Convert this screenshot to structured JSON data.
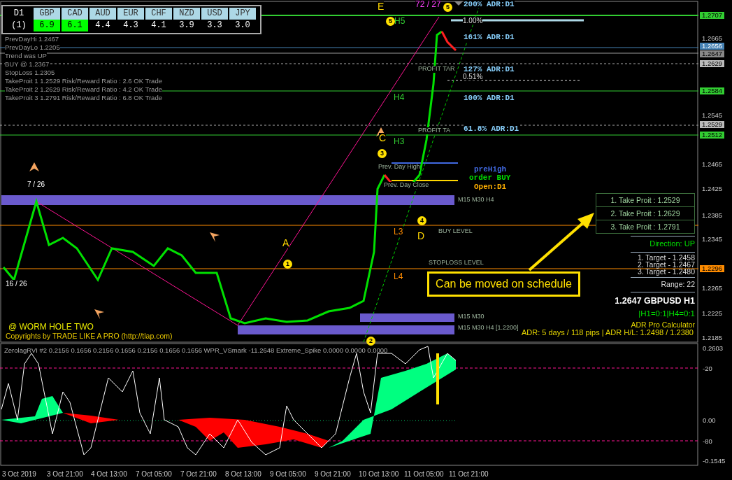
{
  "currency_table": {
    "timeframe": "D1",
    "period": "(1)",
    "currencies": [
      {
        "code": "GBP",
        "value": "6.9",
        "highlighted": true
      },
      {
        "code": "CAD",
        "value": "6.1",
        "highlighted": true
      },
      {
        "code": "AUD",
        "value": "4.4",
        "highlighted": false
      },
      {
        "code": "EUR",
        "value": "4.3",
        "highlighted": false
      },
      {
        "code": "CHF",
        "value": "4.1",
        "highlighted": false
      },
      {
        "code": "NZD",
        "value": "3.9",
        "highlighted": false
      },
      {
        "code": "USD",
        "value": "3.3",
        "highlighted": false
      },
      {
        "code": "JPY",
        "value": "3.0",
        "highlighted": false
      }
    ]
  },
  "info_lines": [
    "PrevDayHi 1.2467",
    "PrevDayLo 1.2205",
    "Trend was UP",
    "BUY @ 1.2367",
    "StopLoss 1.2305",
    "TakeProit 1 1.2529 Risk/Reward Ratio : 2.6 OK Trade",
    "TakeProit 2 1.2629 Risk/Reward Ratio : 4.2 OK Trade",
    "TakeProit 3 1.2791 Risk/Reward Ratio : 6.8 OK Trade"
  ],
  "chart_labels": [
    {
      "text": "E",
      "kind": "yellow"
    },
    {
      "text": "72 / 27",
      "kind": "magenta"
    },
    {
      "text": "200% ADR:D1",
      "kind": "adr"
    },
    {
      "text": "H5",
      "kind": "green"
    },
    {
      "text": "1.00%",
      "kind": "pct"
    },
    {
      "text": "161% ADR:D1",
      "kind": "adr"
    },
    {
      "text": "PROFIT TAR",
      "kind": "gray"
    },
    {
      "text": "127% ADR:D1",
      "kind": "adr"
    },
    {
      "text": "0.51%",
      "kind": "pct"
    },
    {
      "text": "100% ADR:D1",
      "kind": "adr"
    },
    {
      "text": "H4",
      "kind": "green"
    },
    {
      "text": "PROFIT TA",
      "kind": "gray"
    },
    {
      "text": "61.8% ADR:D1",
      "kind": "adr"
    },
    {
      "text": "C",
      "kind": "yellow"
    },
    {
      "text": "H3",
      "kind": "green"
    },
    {
      "text": "Prev. Day High",
      "kind": "gray"
    },
    {
      "text": "preHigh",
      "kind": "blue-bold"
    },
    {
      "text": "order BUY",
      "kind": "green-bold"
    },
    {
      "text": "Prev. Day Close",
      "kind": "gray"
    },
    {
      "text": "Open:D1",
      "kind": "orange-bold"
    },
    {
      "text": "7 / 26",
      "kind": "white"
    },
    {
      "text": "M15 M30 H4",
      "kind": "gray"
    },
    {
      "text": "L3",
      "kind": "orange"
    },
    {
      "text": "BUY LEVEL",
      "kind": "gray"
    },
    {
      "text": "D",
      "kind": "yellow"
    },
    {
      "text": "A",
      "kind": "yellow"
    },
    {
      "text": "STOPLOSS LEVEL",
      "kind": "gray"
    },
    {
      "text": "L4",
      "kind": "orange"
    },
    {
      "text": "16 / 26",
      "kind": "white"
    },
    {
      "text": "M15 M30",
      "kind": "gray"
    },
    {
      "text": "M15 M30 H4  [1.2200]",
      "kind": "gray"
    }
  ],
  "wave_markers": [
    {
      "text": "5"
    },
    {
      "text": "5"
    },
    {
      "text": "3"
    },
    {
      "text": "4"
    },
    {
      "text": "1"
    },
    {
      "text": "2"
    }
  ],
  "price_axis": [
    {
      "text": "1.2707",
      "kind": "green"
    },
    {
      "text": "1.2665",
      "kind": "plain"
    },
    {
      "text": "1.2656",
      "kind": "blue"
    },
    {
      "text": "1.2647",
      "kind": "gray"
    },
    {
      "text": "1.2629",
      "kind": "light"
    },
    {
      "text": "1.2584",
      "kind": "green"
    },
    {
      "text": "1.2545",
      "kind": "plain"
    },
    {
      "text": "1.2529",
      "kind": "light"
    },
    {
      "text": "1.2512",
      "kind": "green"
    },
    {
      "text": "1.2465",
      "kind": "plain"
    },
    {
      "text": "1.2425",
      "kind": "plain"
    },
    {
      "text": "1.2385",
      "kind": "plain"
    },
    {
      "text": "1.2345",
      "kind": "plain"
    },
    {
      "text": "1.2296",
      "kind": "orange"
    },
    {
      "text": "1.2265",
      "kind": "plain"
    },
    {
      "text": "1.2225",
      "kind": "plain"
    },
    {
      "text": "1.2185",
      "kind": "plain"
    }
  ],
  "take_profits": [
    "1. Take Proit : 1.2529",
    "2. Take Proit : 1.2629",
    "3. Take Proit : 1.2791"
  ],
  "direction": "Direction: UP",
  "targets": [
    "1. Target - 1.2458",
    "2. Target - 1.2467",
    "3. Target - 1.2480"
  ],
  "range": "Range: 22",
  "quote": "1.2647 GBPUSD H1",
  "h_ratio": "|H1=0:1|H4=0:1",
  "calculator": "ADR Pro Calculator",
  "adr_summary": "ADR: 5 days / 118 pips | ADR H/L: 1.2498 / 1.2380",
  "callout": "Can be moved on schedule",
  "brand": {
    "name": "@ WORM HOLE TWO",
    "copyright": "Copyrights by TRADE LIKE A PRO (http://tlap.com)"
  },
  "indicator": {
    "header": "ZerolagRVI #2 0.2156 0.1656 0.2156 0.1656 0.2156 0.1656 0.1656   WPR_VSmark -11.2648   Extreme_Spike 0.0000 0.0000 0.0000",
    "axis": [
      "0.2603",
      "-20",
      "0.00",
      "-80",
      "-0.1545"
    ]
  },
  "time_axis": [
    "3 Oct 2019",
    "3 Oct 21:00",
    "4 Oct 13:00",
    "7 Oct 05:00",
    "7 Oct 21:00",
    "8 Oct 13:00",
    "9 Oct 05:00",
    "9 Oct 21:00",
    "10 Oct 13:00",
    "11 Oct 05:00",
    "11 Oct 21:00"
  ]
}
